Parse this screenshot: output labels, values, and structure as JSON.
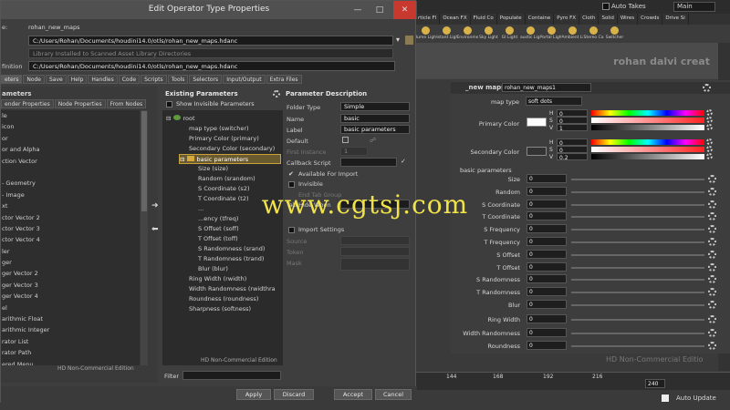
{
  "dialog": {
    "title": "Edit Operator Type Properties",
    "operator_label": "e:",
    "operator_value": "rohan_new_maps",
    "save_to_label": "",
    "save_to_value": "C:/Users/Rohan/Documents/houdini14.0/otls/rohan_new_maps.hdanc",
    "asset_library_value": "Library Installed to Scanned Asset Library Directories",
    "definition_label": "finition",
    "definition_value": "C:/Users/Rohan/Documents/houdini14.0/otls/rohan_new_maps.hdanc",
    "tabs": [
      "eters",
      "Node",
      "Save",
      "Help",
      "Handles",
      "Code",
      "Scripts",
      "Tools",
      "Selectors",
      "Input/Output",
      "Extra Files"
    ],
    "parameters_header": "ameters",
    "left_subtabs": [
      "ender Properties",
      "Node Properties",
      "From Nodes"
    ],
    "left_items": [
      "le",
      "icon",
      "or",
      "or and Alpha",
      "ction Vector",
      "",
      "- Geometry",
      "- Image",
      "xt",
      "ctor Vector 2",
      "ctor Vector 3",
      "ctor Vector 4",
      "ler",
      "ger",
      "ger Vector 2",
      "ger Vector 3",
      "ger Vector 4",
      "el",
      "arithmic Float",
      "arithmic Integer",
      "rator List",
      "rator Path",
      "ered Menu",
      "IA Mask",
      "np (Color)"
    ],
    "left_watermark": "HD Non-Commercial Edition",
    "existing_title": "Existing Parameters",
    "show_invisible": "Show Invisible Parameters",
    "tree": [
      {
        "label": "root",
        "depth": 0,
        "kind": "root"
      },
      {
        "label": "map type (switcher)",
        "depth": 1,
        "kind": "param"
      },
      {
        "label": "Primary Color (primary)",
        "depth": 1,
        "kind": "param"
      },
      {
        "label": "Secondary Color (secondary)",
        "depth": 1,
        "kind": "param"
      },
      {
        "label": "basic parameters",
        "depth": 1,
        "kind": "folder",
        "selected": true
      },
      {
        "label": "Size (size)",
        "depth": 2,
        "kind": "param"
      },
      {
        "label": "Random (srandom)",
        "depth": 2,
        "kind": "param"
      },
      {
        "label": "S Coordinate (s2)",
        "depth": 2,
        "kind": "param"
      },
      {
        "label": "T Coordinate (t2)",
        "depth": 2,
        "kind": "param"
      },
      {
        "label": "...",
        "depth": 2,
        "kind": "param"
      },
      {
        "label": "...ency (tfreq)",
        "depth": 2,
        "kind": "param"
      },
      {
        "label": "S Offset (soff)",
        "depth": 2,
        "kind": "param"
      },
      {
        "label": "T Offset (toff)",
        "depth": 2,
        "kind": "param"
      },
      {
        "label": "S Randomness (srand)",
        "depth": 2,
        "kind": "param"
      },
      {
        "label": "T Randomness (trand)",
        "depth": 2,
        "kind": "param"
      },
      {
        "label": "Blur (blur)",
        "depth": 2,
        "kind": "param"
      },
      {
        "label": "Ring Width (rwidth)",
        "depth": 1,
        "kind": "param"
      },
      {
        "label": "Width Randomness (rwidthra",
        "depth": 1,
        "kind": "param"
      },
      {
        "label": "Roundness (roundness)",
        "depth": 1,
        "kind": "param"
      },
      {
        "label": "Sharpness (softness)",
        "depth": 1,
        "kind": "param"
      }
    ],
    "tree_watermark": "HD Non-Commercial Edition",
    "filter_label": "Filter",
    "desc_title": "Parameter Description",
    "folder_type_label": "Folder Type",
    "folder_type_value": "Simple",
    "name_label": "Name",
    "name_value": "basic",
    "label_label": "Label",
    "label_value": "basic parameters",
    "default_label": "Default",
    "first_instance_label": "First Instance",
    "first_instance_value": "1",
    "callback_label": "Callback Script",
    "available_import": "Available For Import",
    "invisible": "Invisible",
    "end_tab_group": "End Tab Group",
    "tab_hide_when": "Tab Hide When",
    "import_settings": "Import Settings",
    "source_label": "Source",
    "token_label": "Token",
    "mask_label": "Mask",
    "buttons": {
      "apply": "Apply",
      "discard": "Discard",
      "accept": "Accept",
      "cancel": "Cancel"
    }
  },
  "houdini": {
    "auto_takes": "Auto Takes",
    "main_menu": "Main",
    "shelf_tabs": [
      "rticle Fl",
      "Ocean FX",
      "Fluid Co",
      "Populate",
      "Containe",
      "Pyro FX",
      "Cloth",
      "Solid",
      "Wires",
      "Crowds",
      "Drive Si"
    ],
    "shelf_tools": [
      "olume Light",
      "Distant Light",
      "Environme",
      "Sky Light",
      "GI Light",
      "Caustic Light",
      "Portal Light",
      "Ambient Li",
      "Stereo Ca",
      "Switcher"
    ],
    "viewport_text": "rohan dalvi creat",
    "node_type": "_new maps",
    "node_name": "rohan_new_maps1",
    "map_type_label": "map type",
    "map_type_value": "soft dots",
    "primary_label": "Primary Color",
    "secondary_label": "Secondary Color",
    "primary_hsv": [
      {
        "ch": "H",
        "v": "0"
      },
      {
        "ch": "S",
        "v": "0"
      },
      {
        "ch": "V",
        "v": "1"
      }
    ],
    "secondary_hsv": [
      {
        "ch": "H",
        "v": "0"
      },
      {
        "ch": "S",
        "v": "0"
      },
      {
        "ch": "V",
        "v": "0.2"
      }
    ],
    "primary_color": "#ffffff",
    "secondary_color": "#333333",
    "basic_params_label": "basic parameters",
    "params": [
      {
        "label": "Size",
        "value": "0"
      },
      {
        "label": "Random",
        "value": "0"
      },
      {
        "label": "S Coordinate",
        "value": "0"
      },
      {
        "label": "T Coordinate",
        "value": "0"
      },
      {
        "label": "S Frequency",
        "value": "0"
      },
      {
        "label": "T Frequency",
        "value": "0"
      },
      {
        "label": "S Offset",
        "value": "0"
      },
      {
        "label": "T Offset",
        "value": "0"
      },
      {
        "label": "S Randomness",
        "value": "0"
      },
      {
        "label": "T Randomness",
        "value": "0"
      },
      {
        "label": "Blur",
        "value": "0"
      }
    ],
    "outer_params": [
      {
        "label": "Ring Width",
        "value": "0"
      },
      {
        "label": "Width Randomness",
        "value": "0"
      },
      {
        "label": "Roundness",
        "value": "0"
      }
    ],
    "panel_watermark": "HD Non-Commercial Editio",
    "timeline_ticks": [
      "144",
      "168",
      "192",
      "216"
    ],
    "frame_end": "240",
    "auto_update": "Auto Update"
  },
  "watermark": "www.cgtsj.com"
}
